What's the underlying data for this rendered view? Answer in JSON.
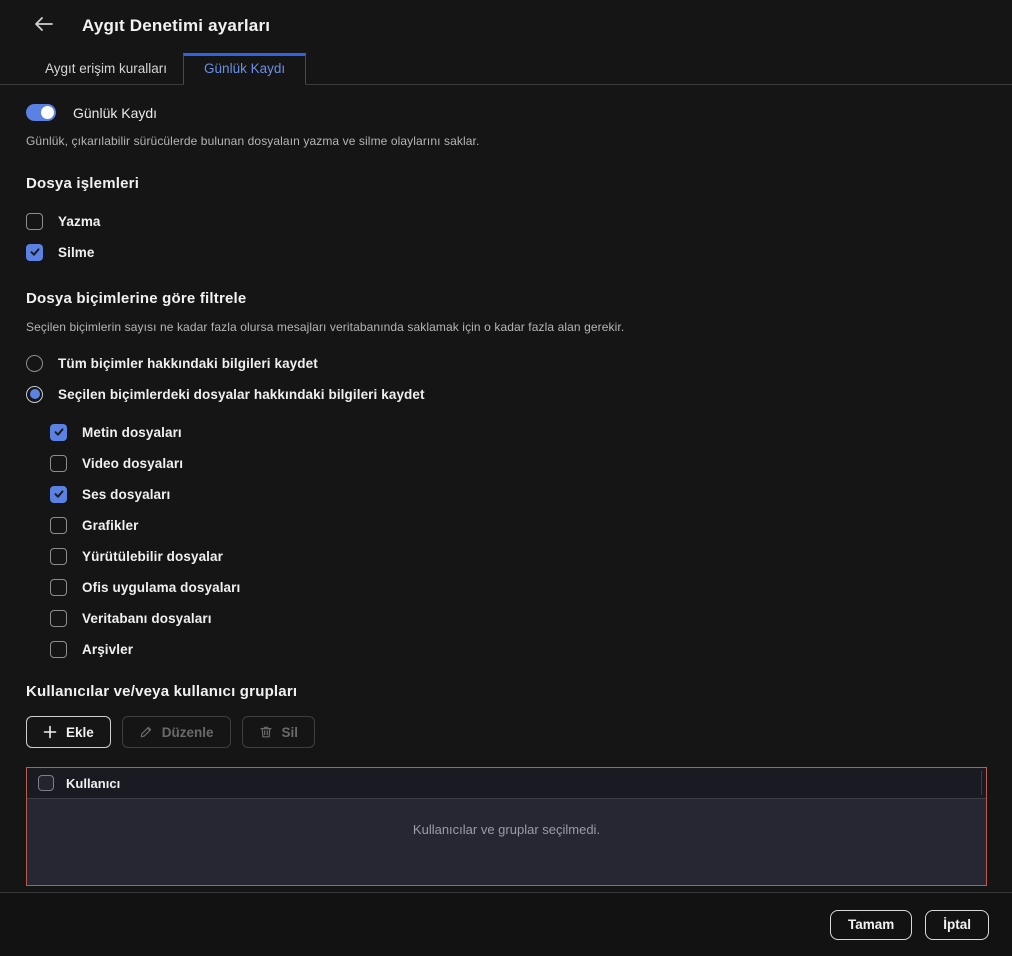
{
  "window": {
    "title": "Aygıt Denetimi ayarları"
  },
  "tabs": [
    {
      "label": "Aygıt erişim kuralları",
      "active": false
    },
    {
      "label": "Günlük Kaydı",
      "active": true
    }
  ],
  "logging": {
    "toggle_label": "Günlük Kaydı",
    "on": true,
    "description": "Günlük, çıkarılabilir sürücülerde bulunan dosyalaın yazma ve silme olaylarını saklar."
  },
  "file_operations": {
    "heading": "Dosya işlemleri",
    "items": [
      {
        "label": "Yazma",
        "checked": false
      },
      {
        "label": "Silme",
        "checked": true
      }
    ]
  },
  "format_filter": {
    "heading": "Dosya biçimlerine göre filtrele",
    "description": "Seçilen biçimlerin sayısı ne kadar fazla olursa mesajları veritabanında saklamak için o kadar fazla alan gerekir.",
    "options": [
      {
        "label": "Tüm biçimler hakkındaki bilgileri kaydet",
        "selected": false
      },
      {
        "label": "Seçilen biçimlerdeki dosyalar hakkındaki bilgileri kaydet",
        "selected": true
      }
    ],
    "formats": [
      {
        "label": "Metin dosyaları",
        "checked": true
      },
      {
        "label": "Video dosyaları",
        "checked": false
      },
      {
        "label": "Ses dosyaları",
        "checked": true
      },
      {
        "label": "Grafikler",
        "checked": false
      },
      {
        "label": "Yürütülebilir dosyalar",
        "checked": false
      },
      {
        "label": "Ofis uygulama dosyaları",
        "checked": false
      },
      {
        "label": "Veritabanı dosyaları",
        "checked": false
      },
      {
        "label": "Arşivler",
        "checked": false
      }
    ]
  },
  "users_section": {
    "heading": "Kullanıcılar ve/veya kullanıcı grupları",
    "toolbar": [
      {
        "label": "Ekle",
        "icon": "plus-icon",
        "enabled": true
      },
      {
        "label": "Düzenle",
        "icon": "pencil-icon",
        "enabled": false
      },
      {
        "label": "Sil",
        "icon": "trash-icon",
        "enabled": false
      }
    ],
    "table": {
      "column_header": "Kullanıcı",
      "header_checkbox_checked": false,
      "empty_text": "Kullanıcılar ve gruplar seçilmedi."
    }
  },
  "footer": {
    "ok_label": "Tamam",
    "cancel_label": "İptal"
  },
  "colors": {
    "accent_blue": "#5b82e2",
    "tab_active_border": "#2e63e6",
    "table_border_red": "#c05b50"
  }
}
